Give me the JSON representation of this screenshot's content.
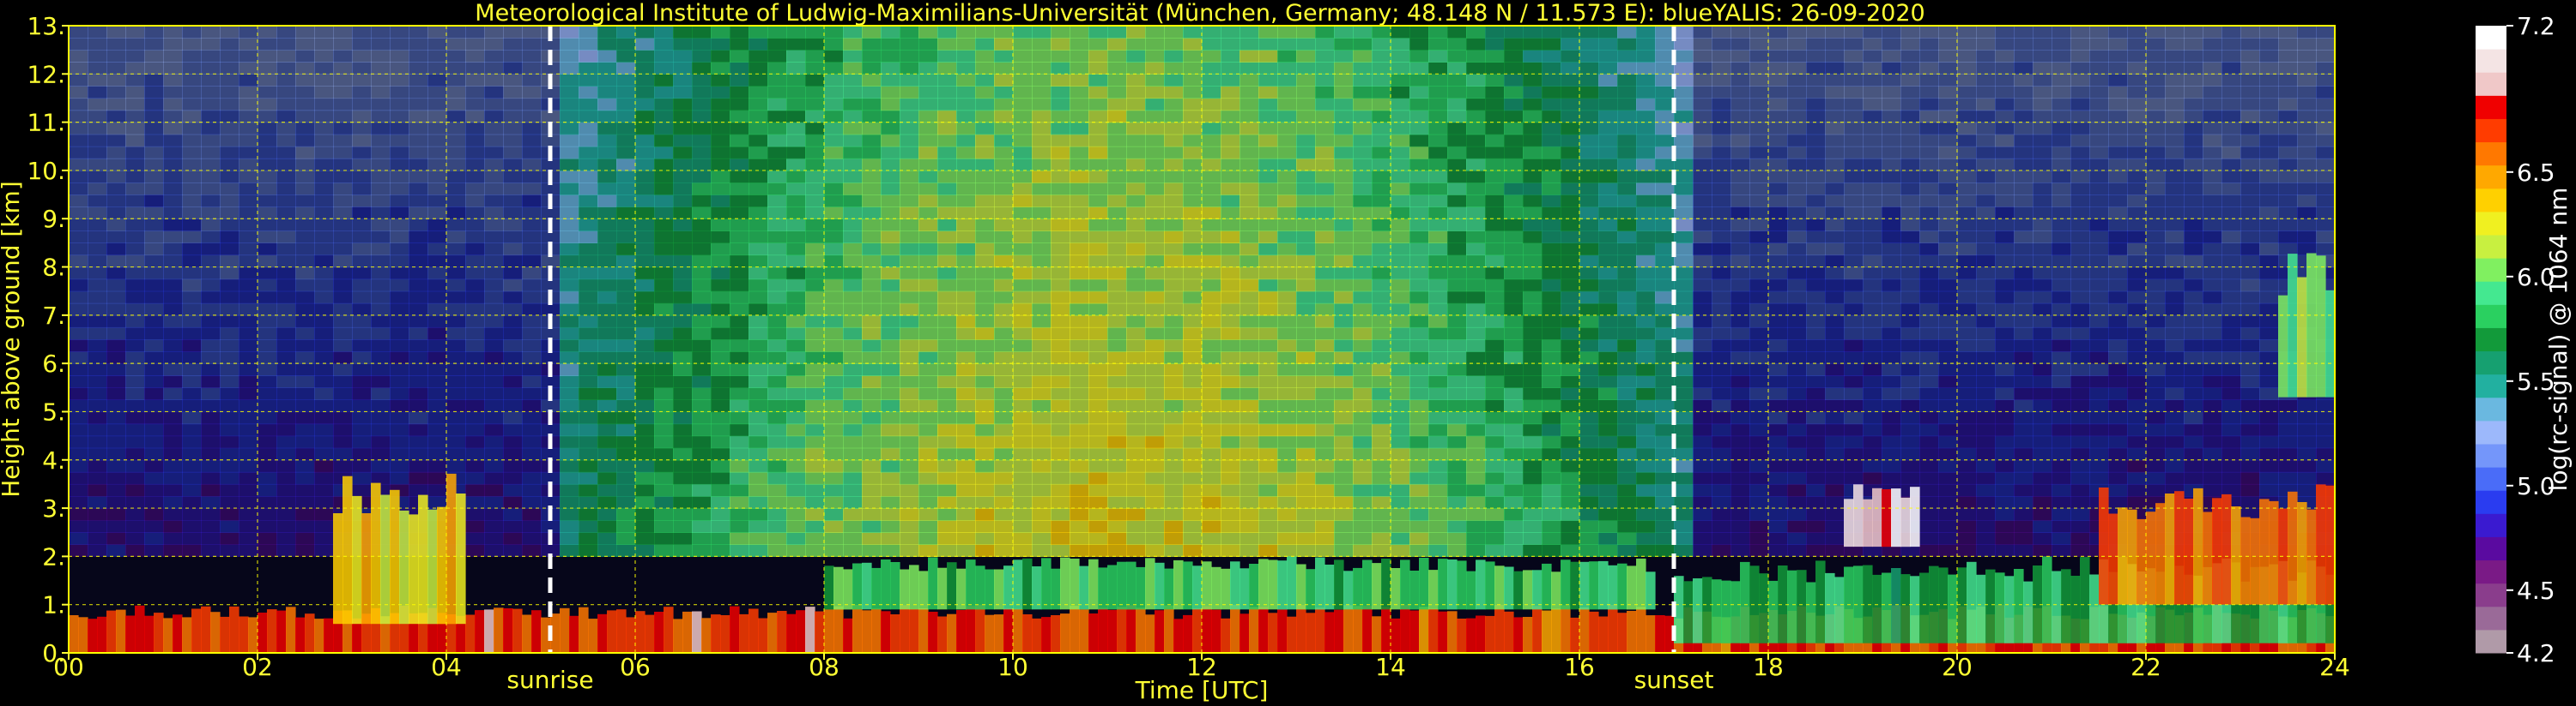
{
  "chart_data": {
    "type": "heatmap",
    "title": "Meteorological Institute of Ludwig-Maximilians-Universität (München, Germany; 48.148 N / 11.573 E):     blueYALIS: 26-09-2020",
    "xlabel": "Time [UTC]",
    "ylabel": "Height above ground [km]",
    "xlim": [
      0,
      24
    ],
    "ylim": [
      0,
      13
    ],
    "x_ticks": [
      0,
      2,
      4,
      6,
      8,
      10,
      12,
      14,
      16,
      18,
      20,
      22,
      24
    ],
    "x_tick_labels": [
      "00",
      "02",
      "04",
      "06",
      "08",
      "10",
      "12",
      "14",
      "16",
      "18",
      "20",
      "22",
      "24"
    ],
    "y_ticks": [
      0,
      1,
      2,
      3,
      4,
      5,
      6,
      7,
      8,
      9,
      10,
      11,
      12,
      13
    ],
    "y_tick_labels": [
      "0.",
      "1.",
      "2.",
      "3.",
      "4.",
      "5.",
      "6.",
      "7.",
      "8.",
      "9.",
      "10.",
      "11.",
      "12.",
      "13."
    ],
    "grid": true,
    "grid_color": "#ffff00",
    "annotations": [
      {
        "label": "sunrise",
        "x": 5.1
      },
      {
        "label": "sunset",
        "x": 17.0
      }
    ],
    "colorbar": {
      "label": "log(rc-signal) @ 1064 nm",
      "range": [
        4.2,
        7.2
      ],
      "ticks": [
        4.2,
        4.5,
        5.0,
        5.5,
        6.0,
        6.5,
        7.2
      ],
      "tick_labels": [
        "4.2",
        "4.5",
        "5.0",
        "5.5",
        "6.0",
        "6.5",
        "7.2"
      ],
      "colors": [
        "#b09aa8",
        "#9a6a98",
        "#8a3d8c",
        "#7a1a86",
        "#5a0aa0",
        "#3a1ad0",
        "#2a3cf0",
        "#4a6cf8",
        "#7496fa",
        "#9cb8fb",
        "#6ab8e0",
        "#22b0a0",
        "#16a070",
        "#129a3a",
        "#2ad060",
        "#44e890",
        "#80f060",
        "#c8f040",
        "#f0f020",
        "#ffd000",
        "#ffa800",
        "#ff7800",
        "#ff3c00",
        "#f00000",
        "#f0c8c8",
        "#f4e4e4",
        "#ffffff"
      ]
    },
    "features": [
      {
        "name": "boundary-layer",
        "x_range": [
          0,
          24
        ],
        "height_km": [
          0,
          1.0
        ],
        "level": 6.7
      },
      {
        "name": "residual-layer-day",
        "x_range": [
          8,
          16.8
        ],
        "height_km": [
          0.9,
          2.0
        ],
        "level": 5.9
      },
      {
        "name": "evening-aerosol",
        "x_range": [
          17,
          24
        ],
        "height_km": [
          0.2,
          2.0
        ],
        "level": 5.8
      },
      {
        "name": "cloud-19h",
        "x_range": [
          18.8,
          19.6
        ],
        "height_km": [
          2.2,
          3.5
        ],
        "level": 7.0
      },
      {
        "name": "cloud-23h",
        "x_range": [
          21.5,
          24
        ],
        "height_km": [
          1.0,
          3.5
        ],
        "level": 6.6
      },
      {
        "name": "elevated-layer-24h",
        "x_range": [
          23.4,
          24
        ],
        "height_km": [
          5.3,
          8.3
        ],
        "level": 6.0
      },
      {
        "name": "plume-03h",
        "x_range": [
          2.8,
          4.2
        ],
        "height_km": [
          0.6,
          3.8
        ],
        "level": 6.3
      }
    ]
  }
}
